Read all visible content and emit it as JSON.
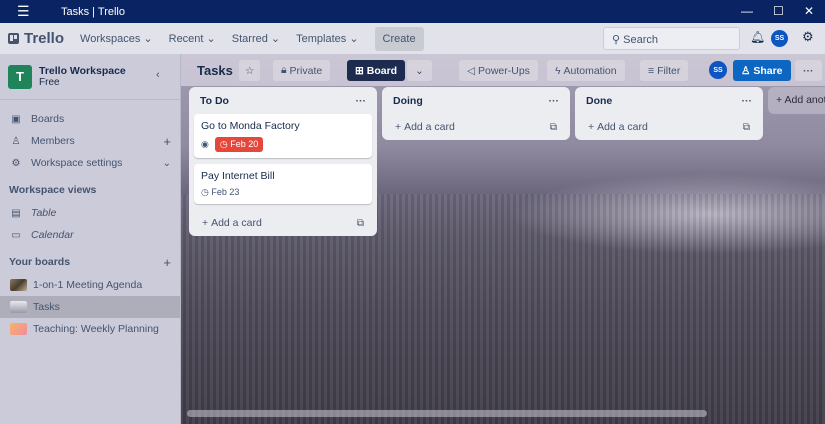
{
  "window": {
    "title": "Tasks | Trello"
  },
  "nav": {
    "logo": "Trello",
    "items": [
      "Workspaces",
      "Recent",
      "Starred",
      "Templates"
    ],
    "create": "Create",
    "search_placeholder": "Search",
    "avatar": "SS"
  },
  "sidebar": {
    "workspace": "Trello Workspace",
    "plan": "Free",
    "initial": "T",
    "items": [
      {
        "label": "Boards",
        "icon": "board-icon"
      },
      {
        "label": "Members",
        "icon": "person-icon"
      },
      {
        "label": "Workspace settings",
        "icon": "gear-icon"
      }
    ],
    "views_heading": "Workspace views",
    "views": [
      "Table",
      "Calendar"
    ],
    "boards_heading": "Your boards",
    "boards": [
      {
        "label": "1-on-1 Meeting Agenda"
      },
      {
        "label": "Tasks"
      },
      {
        "label": "Teaching: Weekly Planning"
      }
    ]
  },
  "board": {
    "title": "Tasks",
    "private": "Private",
    "view": "Board",
    "powerups": "Power-Ups",
    "automation": "Automation",
    "filter": "Filter",
    "avatar": "SS",
    "share": "Share"
  },
  "lists": [
    {
      "title": "To Do",
      "cards": [
        {
          "title": "Go to Monda Factory",
          "due": "Feb 20"
        },
        {
          "title": "Pay Internet Bill",
          "due": "Feb 23"
        }
      ]
    },
    {
      "title": "Doing",
      "cards": []
    },
    {
      "title": "Done",
      "cards": []
    }
  ],
  "add_card": "Add a card",
  "add_list": "Add another list",
  "colors": {
    "titlebar": "#0a2463",
    "share": "#0c66c2",
    "due_overdue": "#e5483a",
    "workspace": "#1f845a"
  }
}
